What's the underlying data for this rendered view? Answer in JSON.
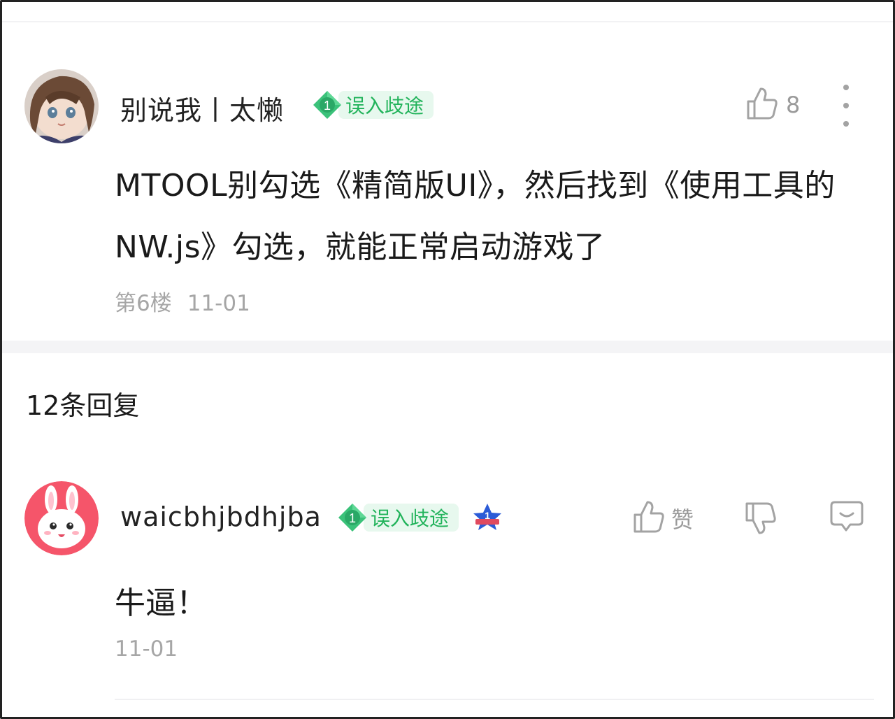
{
  "post": {
    "username": "别说我丨太懒",
    "badge_level": "1",
    "badge_title": "误入歧途",
    "like_count": "8",
    "content": "MTOOL别勾选《精简版UI》，然后找到《使用工具的NW.js》勾选，就能正常启动游戏了",
    "floor": "第6楼",
    "date": "11-01",
    "icons": {
      "like": "thumb-up-icon",
      "more": "more-vertical-icon"
    }
  },
  "replies_header": "12条回复",
  "reply": {
    "username": "waicbhjbdhjba",
    "badge_level": "1",
    "badge_title": "误入歧途",
    "rank_badge": "1",
    "like_label": "赞",
    "content": "牛逼！",
    "date": "11-01",
    "icons": {
      "like": "thumb-up-icon",
      "dislike": "thumb-down-icon",
      "comment": "comment-icon",
      "rank": "star-rank-icon"
    }
  },
  "colors": {
    "badge_green": "#22b35b",
    "badge_bg": "#e7f8ee",
    "muted": "#a6a6a6",
    "rank_blue": "#2b5bd7"
  }
}
